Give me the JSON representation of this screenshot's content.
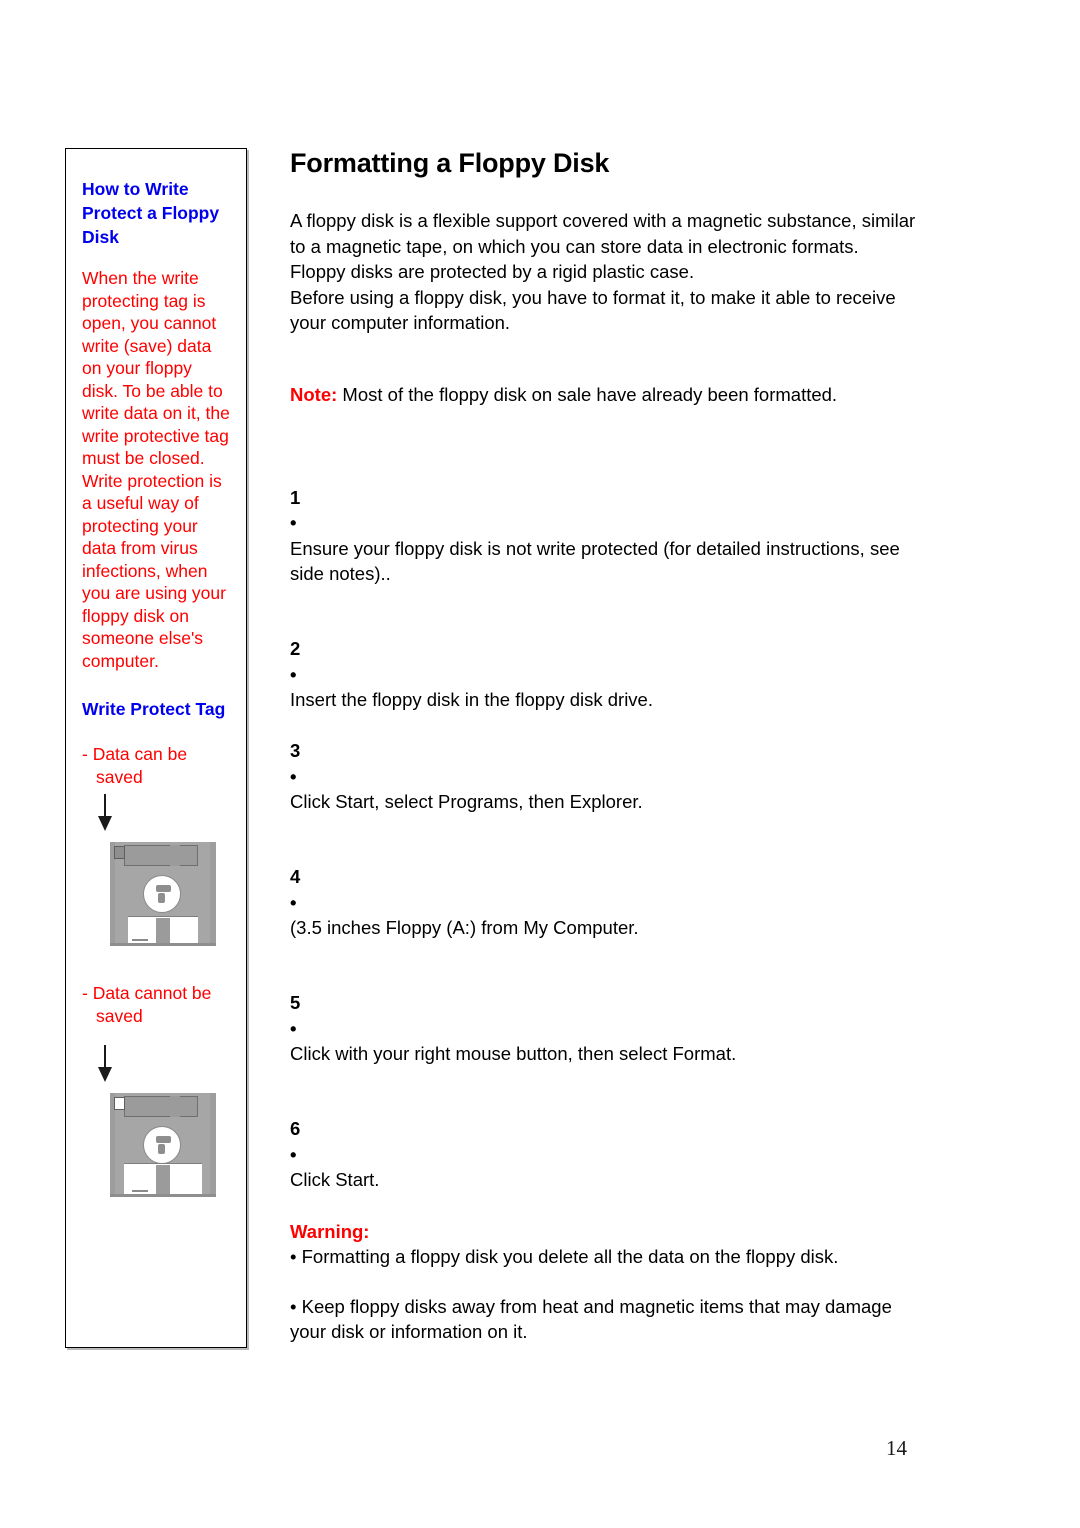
{
  "document": {
    "title": "Formatting a Floppy Disk",
    "page_number": "14"
  },
  "colors": {
    "heading_blue": "#0000EE",
    "alert_red": "#FF0000",
    "text_black": "#000000",
    "disk_gray": "#A6A6A6"
  },
  "sidebar": {
    "heading_1": "How to Write Protect a Floppy Disk",
    "paragraph_1": "When the write protecting tag is open, you cannot write (save) data on your floppy disk. To be able to write data on it, the write protective tag must be closed. Write protection is a useful way of protecting your data from virus infections, when you are using your floppy disk on someone else's computer.",
    "heading_2": "Write Protect Tag",
    "figures": [
      {
        "label": "- Data can be\n  saved",
        "arrow": "down-arrow",
        "image": "floppy-disk-write-protect-closed"
      },
      {
        "label": "- Data cannot be\n  saved",
        "arrow": "down-arrow",
        "image": "floppy-disk-write-protect-open"
      }
    ]
  },
  "main": {
    "intro": "A floppy disk is a flexible support covered with a magnetic substance, similar to a magnetic tape, on which you can store data in electronic formats.\nFloppy disks are protected by a rigid plastic case.\nBefore using a floppy disk, you have to format it, to make it able to receive your computer information.",
    "note": {
      "label": "Note:",
      "text": "Most of the floppy disk on sale have already been formatted."
    },
    "steps": [
      {
        "number": "1",
        "bullet": "•",
        "text": "Ensure your floppy disk is not write protected (for detailed instructions, see side notes).."
      },
      {
        "number": "2",
        "bullet": "•",
        "text": "Insert the floppy disk in the floppy disk drive."
      },
      {
        "number": "3",
        "bullet": "•",
        "text": "Click Start, select Programs, then Explorer."
      },
      {
        "number": "4",
        "bullet": "•",
        "text": "(3.5 inches Floppy (A:) from My Computer."
      },
      {
        "number": "5",
        "bullet": "•",
        "text": "Click with your right mouse button, then select Format."
      },
      {
        "number": "6",
        "bullet": "•",
        "text": "Click Start."
      }
    ],
    "warning": {
      "title": "Warning:",
      "items": [
        "• Formatting a floppy disk you delete all the data on the floppy disk.",
        "• Keep floppy disks away from heat and magnetic items that may damage your disk or information on it."
      ]
    }
  }
}
